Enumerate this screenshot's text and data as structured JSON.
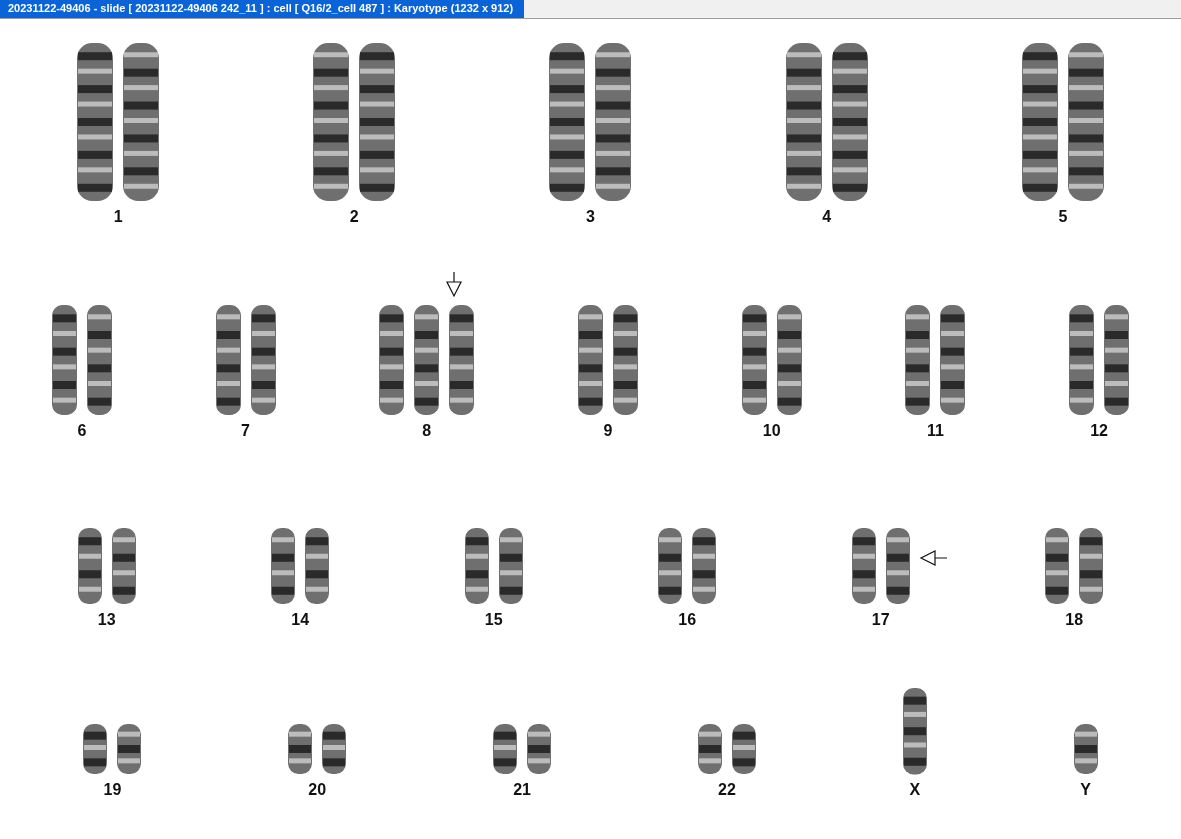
{
  "window": {
    "title": "20231122-49406 - slide [ 20231122-49406 242_11 ] : cell [ Q16/2_cell 487 ] : Karyotype  (1232 x 912)"
  },
  "rows": [
    [
      {
        "label": "1",
        "chromosomes": [
          {
            "kind": "chromosome"
          },
          {
            "kind": "chromosome"
          }
        ]
      },
      {
        "label": "2",
        "chromosomes": [
          {
            "kind": "chromosome"
          },
          {
            "kind": "chromosome"
          }
        ]
      },
      {
        "label": "3",
        "chromosomes": [
          {
            "kind": "chromosome"
          },
          {
            "kind": "chromosome"
          }
        ]
      },
      {
        "label": "4",
        "chromosomes": [
          {
            "kind": "chromosome"
          },
          {
            "kind": "chromosome"
          }
        ]
      },
      {
        "label": "5",
        "chromosomes": [
          {
            "kind": "chromosome"
          },
          {
            "kind": "chromosome"
          }
        ]
      }
    ],
    [
      {
        "label": "6",
        "chromosomes": [
          {
            "kind": "chromosome"
          },
          {
            "kind": "chromosome"
          }
        ]
      },
      {
        "label": "7",
        "chromosomes": [
          {
            "kind": "chromosome"
          },
          {
            "kind": "chromosome"
          }
        ]
      },
      {
        "label": "8",
        "arrow": {
          "kind": "down"
        },
        "chromosomes": [
          {
            "kind": "chromosome"
          },
          {
            "kind": "chromosome"
          },
          {
            "kind": "chromosome"
          }
        ]
      },
      {
        "label": "9",
        "chromosomes": [
          {
            "kind": "chromosome"
          },
          {
            "kind": "chromosome"
          }
        ]
      },
      {
        "label": "10",
        "chromosomes": [
          {
            "kind": "chromosome"
          },
          {
            "kind": "chromosome"
          }
        ]
      },
      {
        "label": "11",
        "chromosomes": [
          {
            "kind": "chromosome"
          },
          {
            "kind": "chromosome"
          }
        ]
      },
      {
        "label": "12",
        "chromosomes": [
          {
            "kind": "chromosome"
          },
          {
            "kind": "chromosome"
          }
        ]
      }
    ],
    [
      {
        "label": "13",
        "chromosomes": [
          {
            "kind": "chromosome"
          },
          {
            "kind": "chromosome"
          }
        ]
      },
      {
        "label": "14",
        "chromosomes": [
          {
            "kind": "chromosome"
          },
          {
            "kind": "chromosome"
          }
        ]
      },
      {
        "label": "15",
        "chromosomes": [
          {
            "kind": "chromosome"
          },
          {
            "kind": "chromosome"
          }
        ]
      },
      {
        "label": "16",
        "chromosomes": [
          {
            "kind": "chromosome"
          },
          {
            "kind": "chromosome"
          }
        ]
      },
      {
        "label": "17",
        "arrow": {
          "kind": "left"
        },
        "chromosomes": [
          {
            "kind": "chromosome"
          },
          {
            "kind": "chromosome"
          }
        ]
      },
      {
        "label": "18",
        "chromosomes": [
          {
            "kind": "chromosome"
          },
          {
            "kind": "chromosome"
          }
        ]
      }
    ],
    [
      {
        "label": "19",
        "chromosomes": [
          {
            "kind": "chromosome"
          },
          {
            "kind": "chromosome"
          }
        ]
      },
      {
        "label": "20",
        "chromosomes": [
          {
            "kind": "chromosome"
          },
          {
            "kind": "chromosome"
          }
        ]
      },
      {
        "label": "21",
        "chromosomes": [
          {
            "kind": "chromosome"
          },
          {
            "kind": "chromosome"
          }
        ]
      },
      {
        "label": "22",
        "chromosomes": [
          {
            "kind": "chromosome"
          },
          {
            "kind": "chromosome"
          }
        ]
      },
      {
        "label": "X",
        "chromosomes": [
          {
            "kind": "chromosome"
          }
        ]
      },
      {
        "label": "Y",
        "chromosomes": [
          {
            "kind": "chromosome"
          }
        ]
      }
    ]
  ]
}
